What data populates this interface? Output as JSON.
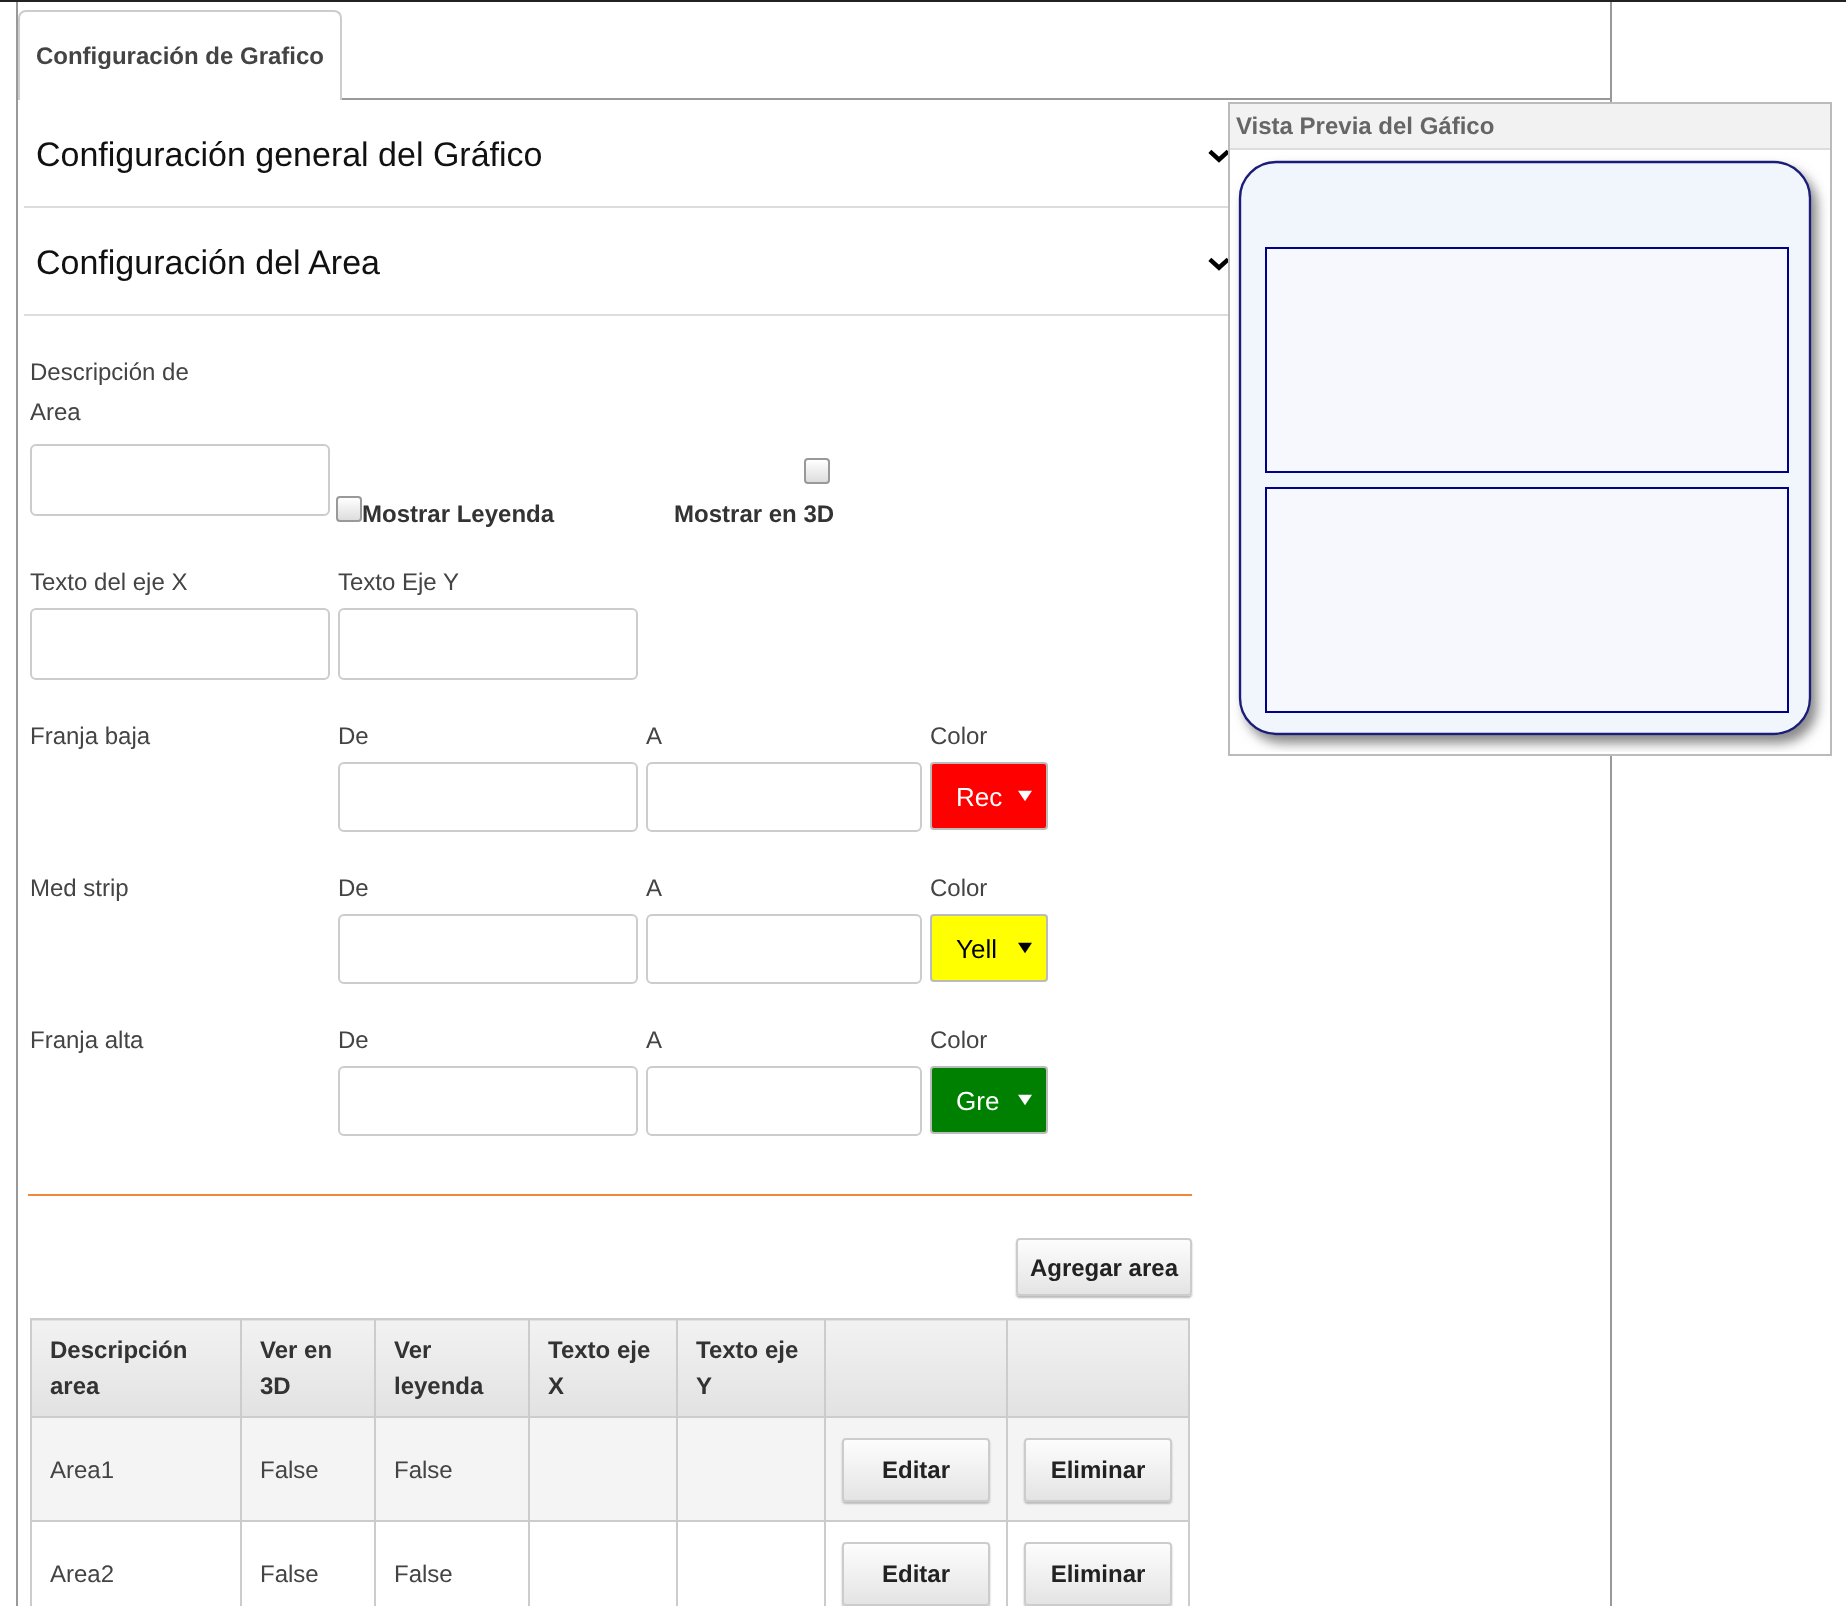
{
  "tabs": [
    {
      "label": "Configuración de Grafico",
      "selected": true
    }
  ],
  "sections": [
    {
      "title": "Configuración general del Gráfico"
    },
    {
      "title": "Configuración del Area"
    }
  ],
  "form": {
    "description_label": "Descripción de Area",
    "legend_checkbox": {
      "label": "Mostrar Leyenda",
      "checked": false
    },
    "threed_checkbox": {
      "label": "Mostrar en 3D",
      "checked": false
    },
    "x_axis_label": "Texto del eje X",
    "y_axis_label": "Texto Eje Y",
    "strips": [
      {
        "label": "Franja baja",
        "from_label": "De",
        "to_label": "A",
        "color_label": "Color",
        "color_value": "Rec",
        "color": "#ff0000"
      },
      {
        "label": "Med strip",
        "from_label": "De",
        "to_label": "A",
        "color_label": "Color",
        "color_value": "Yell",
        "color": "#ffff00"
      },
      {
        "label": "Franja alta",
        "from_label": "De",
        "to_label": "A",
        "color_label": "Color",
        "color_value": "Gre",
        "color": "#008000"
      }
    ]
  },
  "add_button": "Agregar area",
  "table": {
    "columns": [
      "Descripción area",
      "Ver en 3D",
      "Ver leyenda",
      "Texto eje X",
      "Texto eje Y"
    ],
    "rows": [
      {
        "cells": [
          "Area1",
          "False",
          "False",
          "",
          ""
        ],
        "actions": [
          "Editar",
          "Eliminar"
        ]
      },
      {
        "cells": [
          "Area2",
          "False",
          "False",
          "",
          ""
        ],
        "actions": [
          "Editar",
          "Eliminar"
        ]
      }
    ]
  },
  "preview": {
    "title": "Vista Previa del Gáfico"
  }
}
